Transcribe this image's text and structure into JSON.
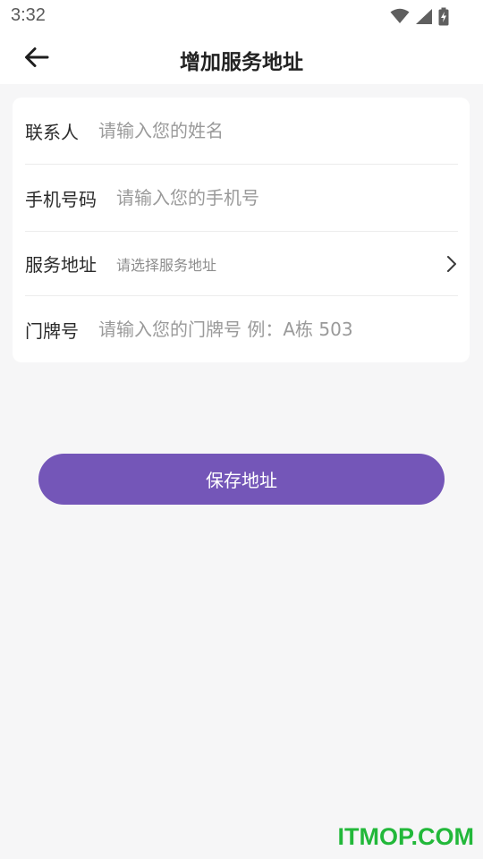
{
  "status_bar": {
    "time": "3:32",
    "icons": [
      "wifi-icon",
      "cellular-signal-icon",
      "battery-charging-icon"
    ]
  },
  "nav": {
    "back_icon": "arrow-left-icon",
    "title": "增加服务地址"
  },
  "form": {
    "contact": {
      "label": "联系人",
      "placeholder": "请输入您的姓名",
      "value": ""
    },
    "phone": {
      "label": "手机号码",
      "placeholder": "请输入您的手机号",
      "value": ""
    },
    "address": {
      "label": "服务地址",
      "placeholder": "请选择服务地址",
      "chevron_icon": "chevron-right-icon"
    },
    "door": {
      "label": "门牌号",
      "placeholder": "请输入您的门牌号 例：A栋 503",
      "value": ""
    }
  },
  "actions": {
    "save_label": "保存地址"
  },
  "watermark": "ITMOP.COM",
  "colors": {
    "accent": "#7456b8",
    "background": "#f6f6f7",
    "card": "#ffffff",
    "watermark": "#22b83a"
  }
}
